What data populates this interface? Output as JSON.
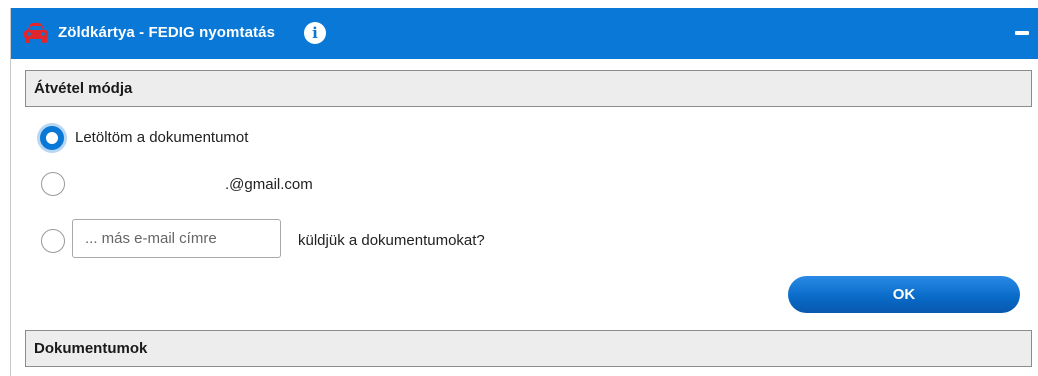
{
  "header": {
    "title": "Zöldkártya - FEDIG nyomtatás",
    "info_glyph": "i",
    "icons": {
      "left": "car-icon",
      "info": "info-icon",
      "collapse": "minus-icon"
    },
    "accent_color": "#0a78d7",
    "car_icon_color": "#e0262d"
  },
  "delivery": {
    "section_title": "Átvétel módja",
    "options": [
      {
        "label": "Letöltöm a dokumentumot",
        "checked": true
      },
      {
        "label": ".@gmail.com",
        "checked": false
      },
      {
        "label": "küldjük a dokumentumokat?",
        "checked": false
      }
    ],
    "email_input": {
      "placeholder": "... más e-mail címre",
      "value": ""
    },
    "ok_label": "OK"
  },
  "documents": {
    "section_title": "Dokumentumok"
  }
}
